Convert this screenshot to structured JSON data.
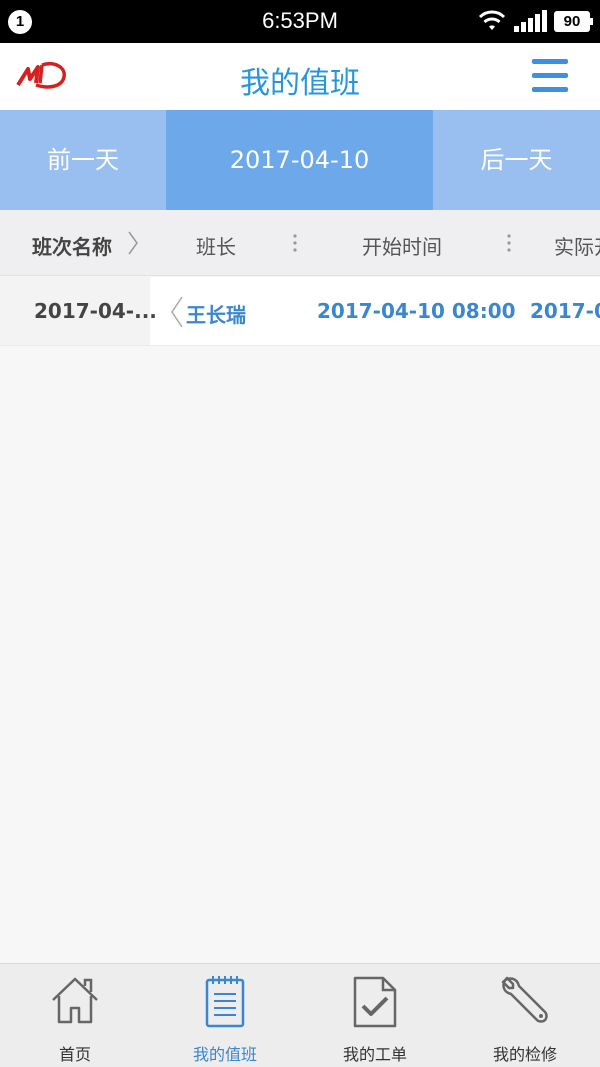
{
  "status_bar": {
    "notification_count": "1",
    "time": "6:53PM",
    "battery": "90",
    "icons": [
      "wifi-icon",
      "signal-icon",
      "battery-icon"
    ]
  },
  "header": {
    "title": "我的值班",
    "logo_icon": "logo-icon",
    "menu_icon": "menu-icon"
  },
  "date_nav": {
    "prev_label": "前一天",
    "current_date": "2017-04-10",
    "next_label": "后一天"
  },
  "table": {
    "columns": [
      "班次名称",
      "班长",
      "开始时间",
      "实际开"
    ],
    "rows": [
      {
        "shift_name": "2017-04-...",
        "leader": "王长瑞",
        "start_time": "2017-04-10 08:00",
        "actual_time": "2017-0"
      }
    ]
  },
  "bottom_nav": {
    "items": [
      {
        "label": "首页",
        "icon": "home-icon",
        "active": false
      },
      {
        "label": "我的值班",
        "icon": "notepad-icon",
        "active": true
      },
      {
        "label": "我的工单",
        "icon": "document-check-icon",
        "active": false
      },
      {
        "label": "我的检修",
        "icon": "wrench-icon",
        "active": false
      }
    ]
  },
  "colors": {
    "accent": "#2796dc",
    "date_bar": "#98bff0",
    "date_active": "#6ca8ea",
    "link": "#3a86cf"
  }
}
